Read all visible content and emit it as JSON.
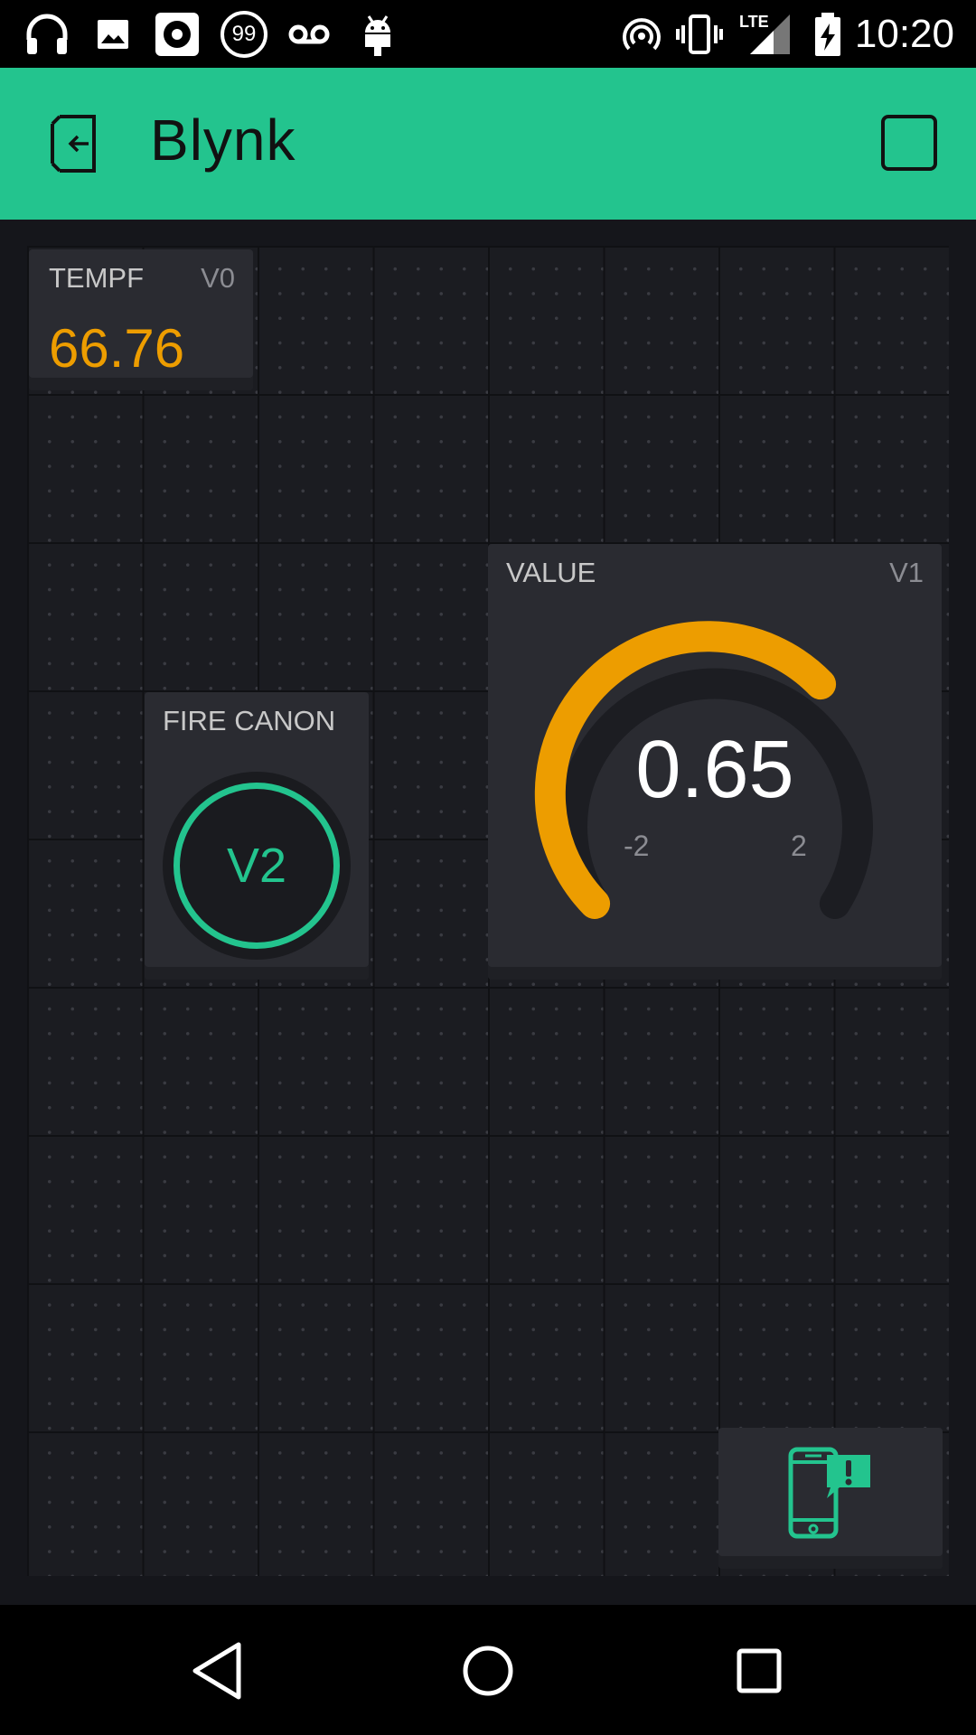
{
  "status_bar": {
    "time": "10:20",
    "notification_badge": "99",
    "network_label": "LTE",
    "icons": [
      "headphones-icon",
      "image-icon",
      "music-icon",
      "badge-99-icon",
      "voicemail-icon",
      "android-icon",
      "hotspot-icon",
      "vibrate-icon",
      "signal-icon",
      "battery-charging-icon"
    ]
  },
  "app_bar": {
    "title": "Blynk",
    "exit_icon": "exit-icon",
    "square_icon": "stop-square-icon"
  },
  "widgets": {
    "tempf": {
      "label": "TEMPF",
      "pin": "V0",
      "value": "66.76",
      "color": "#ed9d00"
    },
    "fire_canon": {
      "label": "FIRE CANON",
      "button_text": "V2",
      "color": "#23c48e"
    },
    "gauge": {
      "label": "VALUE",
      "pin": "V1",
      "value": "0.65",
      "min": "-2",
      "max": "2",
      "color": "#ed9d00"
    },
    "notification": {
      "icon": "phone-notification-icon",
      "color": "#23c48e"
    }
  },
  "nav_bar": {
    "icons": [
      "back-icon",
      "home-icon",
      "recents-icon"
    ]
  },
  "colors": {
    "accent": "#23c48e",
    "background": "#1b1c21",
    "widget": "#2a2b31"
  }
}
